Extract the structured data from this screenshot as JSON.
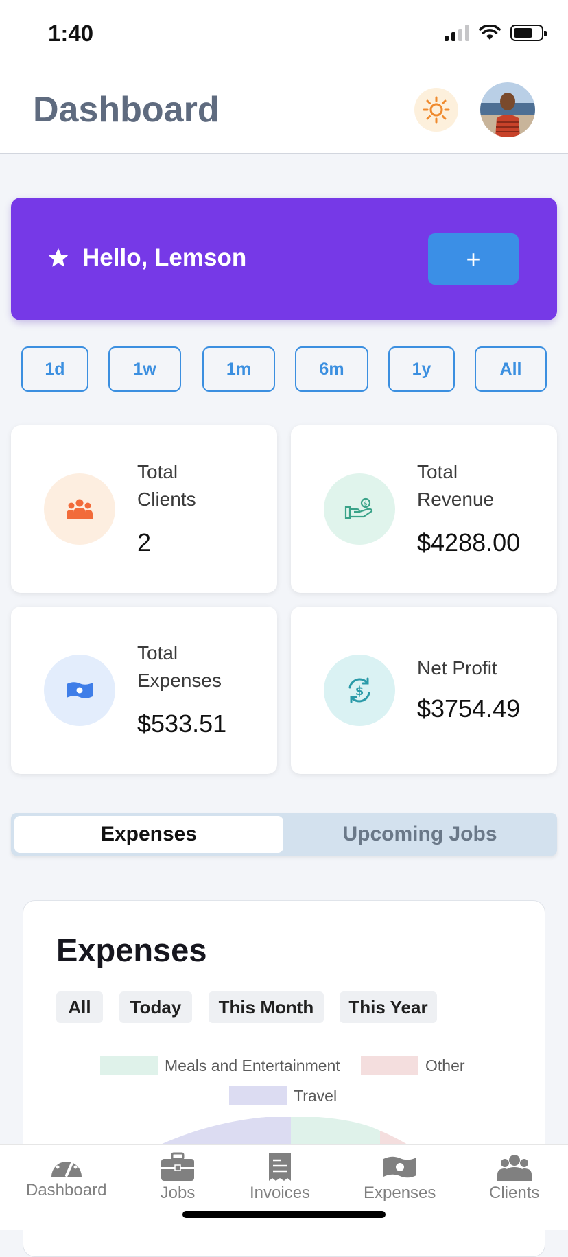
{
  "status_bar": {
    "time": "1:40"
  },
  "header": {
    "title": "Dashboard"
  },
  "hero": {
    "greeting": "Hello, Lemson",
    "add_label": "+"
  },
  "time_ranges": [
    "1d",
    "1w",
    "1m",
    "6m",
    "1y",
    "All"
  ],
  "stats": {
    "clients": {
      "label_line1": "Total",
      "label_line2": "Clients",
      "value": "2",
      "color": "#f26b3a"
    },
    "revenue": {
      "label_line1": "Total",
      "label_line2": "Revenue",
      "value": "$4288.00",
      "color": "#3aa389"
    },
    "expenses": {
      "label_line1": "Total",
      "label_line2": "Expenses",
      "value": "$533.51",
      "color": "#3f7ee8"
    },
    "profit": {
      "label": "Net Profit",
      "value": "$3754.49",
      "color": "#2a9aa8"
    }
  },
  "segments": {
    "active": "Expenses",
    "inactive": "Upcoming Jobs"
  },
  "expenses_panel": {
    "title": "Expenses",
    "filters": [
      "All",
      "Today",
      "This Month",
      "This Year"
    ],
    "legend": [
      {
        "label": "Meals and Entertainment",
        "color": "#dff2ea"
      },
      {
        "label": "Other",
        "color": "#f4dede"
      },
      {
        "label": "Travel",
        "color": "#dcdcf2"
      }
    ]
  },
  "tab_bar": {
    "items": [
      "Dashboard",
      "Jobs",
      "Invoices",
      "Expenses",
      "Clients"
    ]
  },
  "colors": {
    "accent": "#7639e7",
    "primary_blue": "#3b8fe0"
  }
}
